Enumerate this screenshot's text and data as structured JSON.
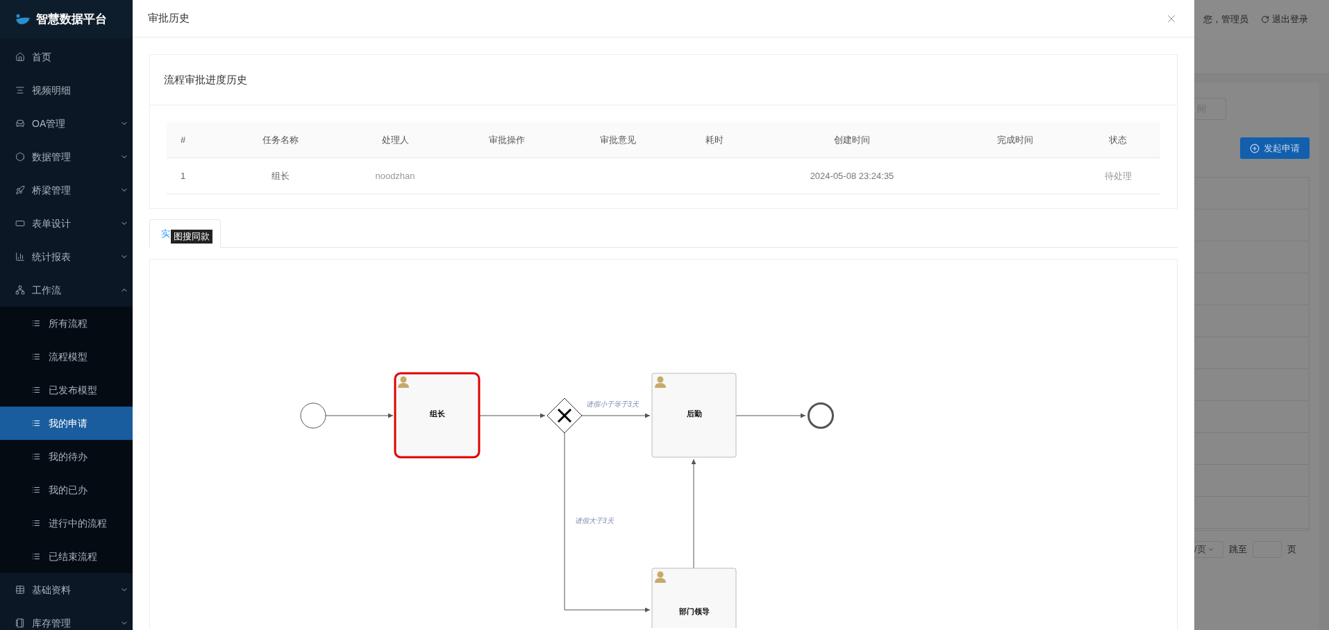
{
  "sidebar": {
    "logo": "智慧数据平台",
    "items": [
      {
        "kind": "link",
        "label": "首页"
      },
      {
        "kind": "link",
        "label": "视频明细"
      },
      {
        "kind": "group",
        "label": "OA管理",
        "expanded": false
      },
      {
        "kind": "group",
        "label": "数据管理",
        "expanded": false
      },
      {
        "kind": "group",
        "label": "桥梁管理",
        "expanded": false
      },
      {
        "kind": "group",
        "label": "表单设计",
        "expanded": false
      },
      {
        "kind": "group",
        "label": "统计报表",
        "expanded": false
      },
      {
        "kind": "group",
        "label": "工作流",
        "expanded": true,
        "children": [
          {
            "label": "所有流程",
            "selected": false
          },
          {
            "label": "流程模型",
            "selected": false
          },
          {
            "label": "已发布模型",
            "selected": false
          },
          {
            "label": "我的申请",
            "selected": true
          },
          {
            "label": "我的待办",
            "selected": false
          },
          {
            "label": "我的已办",
            "selected": false
          },
          {
            "label": "进行中的流程",
            "selected": false
          },
          {
            "label": "已结束流程",
            "selected": false
          }
        ]
      },
      {
        "kind": "group",
        "label": "基础资料",
        "expanded": false
      },
      {
        "kind": "group",
        "label": "库存管理",
        "expanded": false
      }
    ]
  },
  "background_page": {
    "user": "您，管理员",
    "logout": "退出登录",
    "search_placeholder": "间",
    "start_button": "发起申请",
    "page_size": "/页",
    "jump_label": "跳至",
    "page_suffix": "页"
  },
  "modal": {
    "title": "审批历史",
    "card_title": "流程审批进度历史",
    "table": {
      "columns": [
        "#",
        "任务名称",
        "处理人",
        "审批操作",
        "审批意见",
        "耗时",
        "创建时间",
        "完成时间",
        "状态"
      ],
      "rows": [
        {
          "index": "1",
          "task": "组长",
          "assignee": "noodzhan",
          "created": "2024-05-08 23:24:35",
          "status": "待处理"
        }
      ]
    },
    "tabs": [
      {
        "label": "实",
        "selected": true
      }
    ],
    "tooltip": "图搜同款",
    "diagram": {
      "nodes": [
        {
          "kind": "start"
        },
        {
          "kind": "task",
          "label": "组长",
          "current": true
        },
        {
          "kind": "gateway"
        },
        {
          "kind": "task",
          "label": "后勤",
          "current": false
        },
        {
          "kind": "end"
        },
        {
          "kind": "task",
          "label": "部门领导",
          "current": false
        }
      ],
      "flows": [
        {
          "kind": "plain"
        },
        {
          "kind": "plain"
        },
        {
          "kind": "labeled",
          "label": "请假小于等于3天"
        },
        {
          "kind": "plain"
        },
        {
          "kind": "labeled",
          "label": "请假大于3天"
        },
        {
          "kind": "plain"
        }
      ]
    }
  }
}
